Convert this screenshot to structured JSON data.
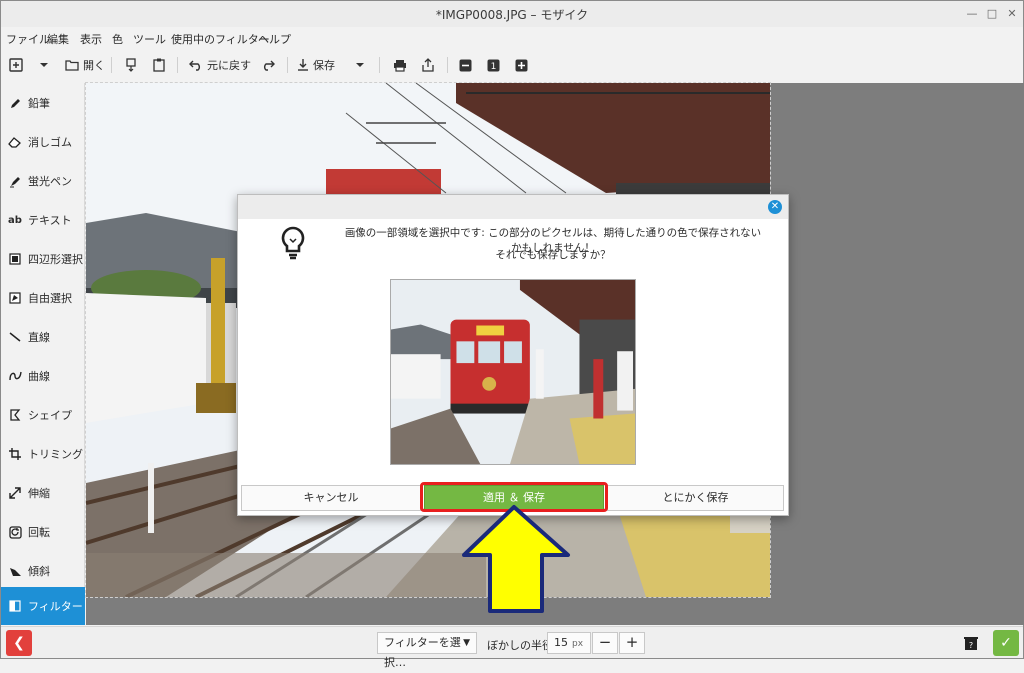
{
  "window": {
    "title": "*IMGP0008.JPG – モザイク",
    "minimize_icon": "minimize-icon",
    "maximize_icon": "maximize-icon",
    "close_icon": "close-icon"
  },
  "menu": [
    "ファイル",
    "編集",
    "表示",
    "色",
    "ツール",
    "使用中のフィルター",
    "ヘルプ"
  ],
  "toolbar": {
    "open_label": "開く",
    "undo_label": "元に戻す",
    "save_label": "保存",
    "zoom_value": "1"
  },
  "sidebar": {
    "items": [
      {
        "label": "鉛筆",
        "icon": "pencil-icon"
      },
      {
        "label": "消しゴム",
        "icon": "eraser-icon"
      },
      {
        "label": "蛍光ペン",
        "icon": "highlighter-icon"
      },
      {
        "label": "テキスト",
        "icon": "text-icon"
      },
      {
        "label": "四辺形選択",
        "icon": "rect-select-icon"
      },
      {
        "label": "自由選択",
        "icon": "free-select-icon"
      },
      {
        "label": "直線",
        "icon": "line-icon"
      },
      {
        "label": "曲線",
        "icon": "curve-icon"
      },
      {
        "label": "シェイプ",
        "icon": "shape-icon"
      },
      {
        "label": "トリミング",
        "icon": "crop-icon"
      },
      {
        "label": "伸縮",
        "icon": "scale-icon"
      },
      {
        "label": "回転",
        "icon": "rotate-icon"
      },
      {
        "label": "傾斜",
        "icon": "skew-icon"
      },
      {
        "label": "フィルター",
        "icon": "filter-icon"
      }
    ],
    "active_index": 13
  },
  "dialog": {
    "message_line1": "画像の一部領域を選択中です: この部分のピクセルは、期待した通りの色で保存されないかもしれません！",
    "message_line2": "それでも保存しますか？",
    "cancel_label": "キャンセル",
    "apply_save_label": "適用 ＆ 保存",
    "force_save_label": "とにかく保存",
    "icon": "lightbulb-icon"
  },
  "bottombar": {
    "filter_select": "フィルターを選択…",
    "blur_label": "ぼかしの半径",
    "blur_value": "15",
    "blur_unit": "px"
  },
  "colors": {
    "accent": "#1e90d6",
    "apply_green": "#74b843",
    "cancel_red": "#e2403c",
    "highlight_red": "#e81f1f",
    "arrow_yellow": "#ffff00",
    "arrow_stroke": "#1a2a7a"
  }
}
